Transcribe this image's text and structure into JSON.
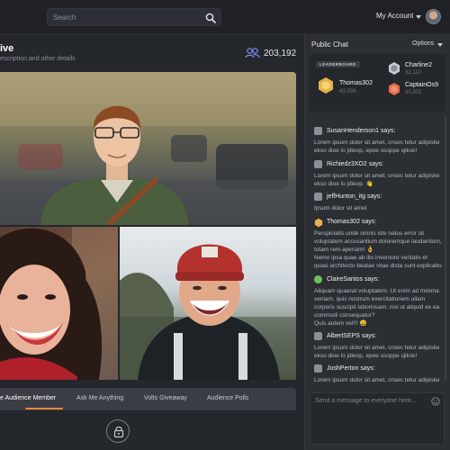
{
  "search": {
    "placeholder": "Search"
  },
  "account": {
    "label": "My Account"
  },
  "stream": {
    "title": "ive",
    "subtitle": "escription and other details",
    "viewers": "203,192"
  },
  "tabs": [
    {
      "label": "e Audience Member",
      "active": true
    },
    {
      "label": "Ask Me Anything"
    },
    {
      "label": "Volts Giveaway"
    },
    {
      "label": "Audience Polls"
    }
  ],
  "chat_panel": {
    "title": "Public Chat",
    "options_label": "Options",
    "leaderboard": {
      "label": "LEADERBOARD",
      "entries": [
        {
          "name": "Thomas302",
          "score": "43,099",
          "color": "#e8b04a"
        },
        {
          "name": "Charline2",
          "score": "32,110",
          "color": "#c9ccd2"
        },
        {
          "name": "CaptainOs9",
          "score": "30,802",
          "color": "#e86a4a"
        }
      ]
    },
    "messages": [
      {
        "user": "SusanHenderson1 says:",
        "text": [
          "Lorem ipsum dolor sit amet, cnsec tetur adipiske",
          "ekso dioe lo jdieop, epoe ssoppe sjiksk!"
        ]
      },
      {
        "user": "Richiedz3XO2 says:",
        "text": [
          "Lorem ipsum dolor sit amet, cnsec tetur adipiske",
          "ekso dioe lo jdieop. 👋"
        ]
      },
      {
        "user": "jeffHunton_itg says:",
        "text": [
          "Ipsum dolor sit amet"
        ]
      },
      {
        "user": "Thomas302 says:",
        "text": [
          "Perspiciatis unde omnis iste natus error sit",
          "voluptatem accusantium doloremque laudantium,",
          "totam rem aperiam! 👌",
          "Nemo ipsa quae ab illo inventore veritatis et",
          "quasi architecto beatae vitae dicta sunt explicabo"
        ]
      },
      {
        "user": "ClaireSantos says:",
        "text": [
          "Aliquam quaerat voluptatem. Ut enim ad minima",
          "veniam, quis nostrum exercitationem ullam",
          "corporis suscipit laboriosam, nisi ut aliquid ex ea",
          "commodi consequatur?",
          "Quis autem vel!!! 😀"
        ]
      },
      {
        "user": "AlbertSEPS says:",
        "text": [
          "Lorem ipsum dolor sit amet, cnsec tetur adipiske",
          "ekso dioe lo jdieop, epoe ssoppe sjiksk!"
        ]
      },
      {
        "user": "JoshPerton says:",
        "text": [
          "Lorem ipsum dolor sit amet, cnsec tetur adipiske"
        ]
      }
    ],
    "compose_placeholder": "Send a message to everyone here..."
  },
  "colors": {
    "accent": "#e88a3a",
    "viewers_icon": "#7d8cf0"
  }
}
